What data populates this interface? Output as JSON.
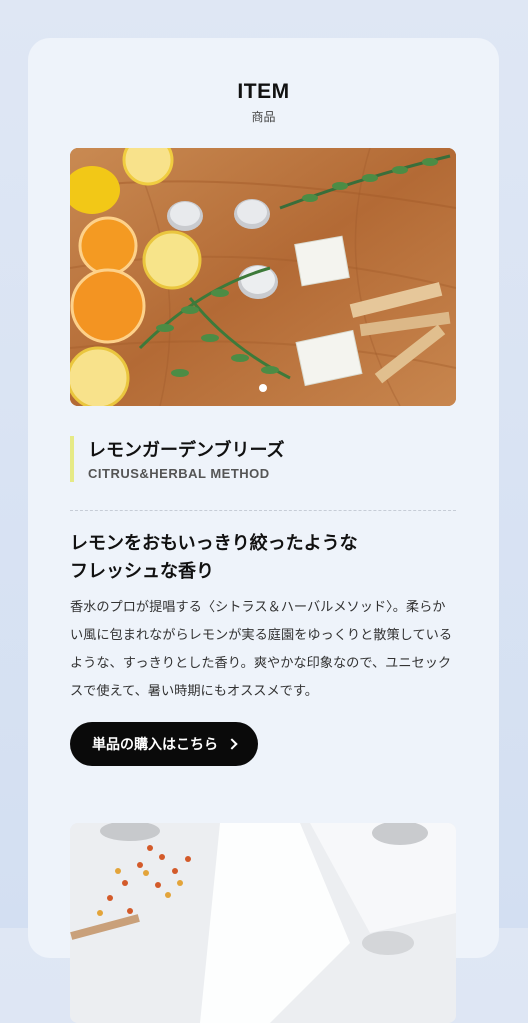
{
  "section": {
    "title": "ITEM",
    "subtitle": "商品"
  },
  "product": {
    "name_jp": "レモンガーデンブリーズ",
    "name_en": "CITRUS&HERBAL METHOD",
    "catch_line1": "レモンをおもいっきり絞ったような",
    "catch_line2": "フレッシュな香り",
    "description": "香水のプロが提唱する〈シトラス＆ハーバルメソッド〉。柔らかい風に包まれながらレモンが実る庭園をゆっくりと散策しているような、すっきりとした香り。爽やかな印象なので、ユニセックスで使えて、暑い時期にもオススメです。",
    "buy_label": "単品の購入はこちら"
  },
  "carousel": {
    "slide_count": 1,
    "active_index": 0
  },
  "colors": {
    "accent_bar": "#e6ea86",
    "button_bg": "#0a0a0a",
    "card_bg": "#eef3fa"
  }
}
